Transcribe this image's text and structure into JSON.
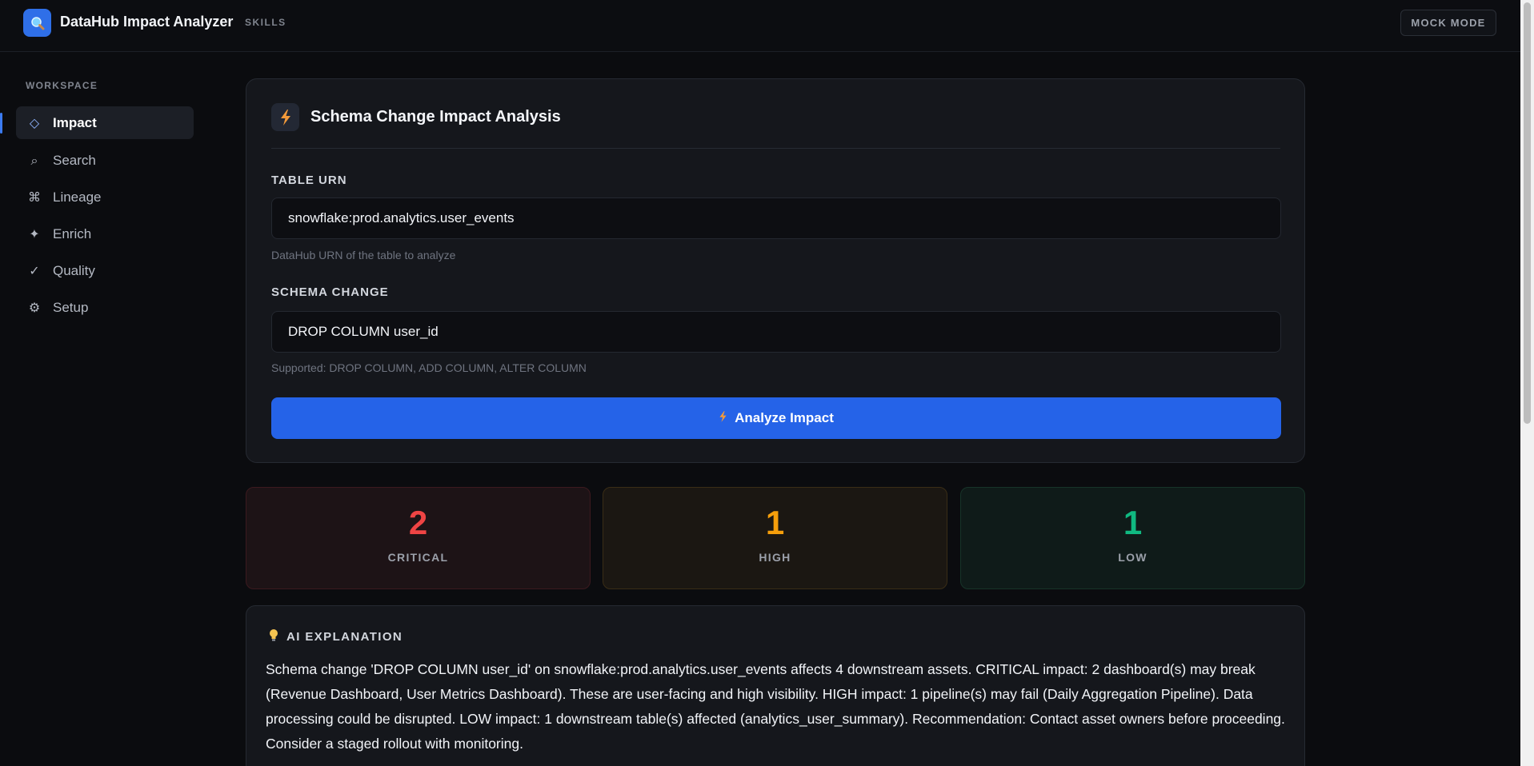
{
  "header": {
    "title": "DataHub Impact Analyzer",
    "subtitle": "SKILLS",
    "mode_button": "MOCK MODE",
    "logo_icon": "magnifier-icon"
  },
  "sidebar": {
    "heading": "WORKSPACE",
    "items": [
      {
        "label": "Impact",
        "icon": "◇",
        "icon_name": "diamond-icon",
        "active": true
      },
      {
        "label": "Search",
        "icon": "⌕",
        "icon_name": "search-icon",
        "active": false
      },
      {
        "label": "Lineage",
        "icon": "⌘",
        "icon_name": "command-icon",
        "active": false
      },
      {
        "label": "Enrich",
        "icon": "✦",
        "icon_name": "sparkle-icon",
        "active": false
      },
      {
        "label": "Quality",
        "icon": "✓",
        "icon_name": "check-icon",
        "active": false
      },
      {
        "label": "Setup",
        "icon": "⚙",
        "icon_name": "gear-icon",
        "active": false
      }
    ]
  },
  "form": {
    "title": "Schema Change Impact Analysis",
    "title_icon": "lightning-icon",
    "table_urn": {
      "label": "TABLE URN",
      "value": "snowflake:prod.analytics.user_events",
      "hint": "DataHub URN of the table to analyze"
    },
    "schema_change": {
      "label": "SCHEMA CHANGE",
      "value": "DROP COLUMN user_id",
      "hint": "Supported: DROP COLUMN, ADD COLUMN, ALTER COLUMN"
    },
    "submit_label": "Analyze Impact"
  },
  "stats": {
    "critical": {
      "count": "2",
      "label": "CRITICAL",
      "color": "#ef4444"
    },
    "high": {
      "count": "1",
      "label": "HIGH",
      "color": "#f59e0b"
    },
    "low": {
      "count": "1",
      "label": "LOW",
      "color": "#10b981"
    }
  },
  "ai_explanation": {
    "heading": "AI EXPLANATION",
    "icon": "lightbulb-icon",
    "text": "Schema change 'DROP COLUMN user_id' on snowflake:prod.analytics.user_events affects 4 downstream assets. CRITICAL impact: 2 dashboard(s) may break (Revenue Dashboard, User Metrics Dashboard). These are user-facing and high visibility. HIGH impact: 1 pipeline(s) may fail (Daily Aggregation Pipeline). Data processing could be disrupted. LOW impact: 1 downstream table(s) affected (analytics_user_summary). Recommendation: Contact asset owners before proceeding. Consider a staged rollout with monitoring."
  },
  "colors": {
    "accent": "#2563e8",
    "background": "#0b0c0f",
    "card": "#15171c"
  }
}
